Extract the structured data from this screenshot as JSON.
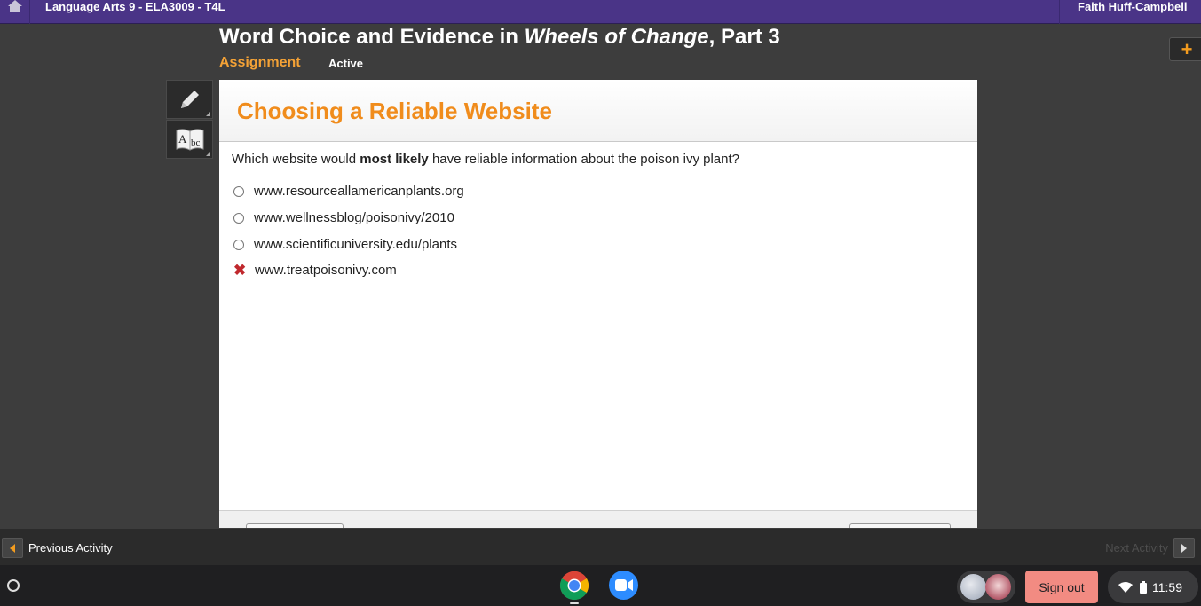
{
  "topbar": {
    "course_title": "Language Arts 9 - ELA3009 - T4L",
    "user_name": "Faith Huff-Campbell"
  },
  "header": {
    "title_prefix": "Word Choice and Evidence in ",
    "title_italic": "Wheels of Change",
    "title_suffix": ", Part 3",
    "assignment_label": "Assignment",
    "status": "Active"
  },
  "tools": [
    {
      "name": "pencil-icon"
    },
    {
      "name": "dictionary-icon",
      "glyph_a": "A",
      "glyph_bc": "bc"
    }
  ],
  "card": {
    "title": "Choosing a Reliable Website",
    "question": {
      "before": "Which website would ",
      "bold": "most likely",
      "after": " have reliable information about the poison ivy plant?"
    },
    "options": [
      {
        "text": "www.resourceallamericanplants.org",
        "state": "unselected"
      },
      {
        "text": "www.wellnessblog/poisonivy/2010",
        "state": "unselected"
      },
      {
        "text": "www.scientificuniversity.edu/plants",
        "state": "unselected"
      },
      {
        "text": "www.treatpoisonivy.com",
        "state": "incorrect",
        "mark": "✖"
      }
    ]
  },
  "activity_nav": {
    "prev_label": "Previous Activity",
    "next_label": "Next Activity"
  },
  "shelf": {
    "sign_out_label": "Sign out",
    "clock": "11:59"
  },
  "colors": {
    "topbar": "#4a3487",
    "accent_orange": "#f08c1c",
    "incorrect_red": "#c0282d",
    "signout_pink": "#f28b82"
  }
}
